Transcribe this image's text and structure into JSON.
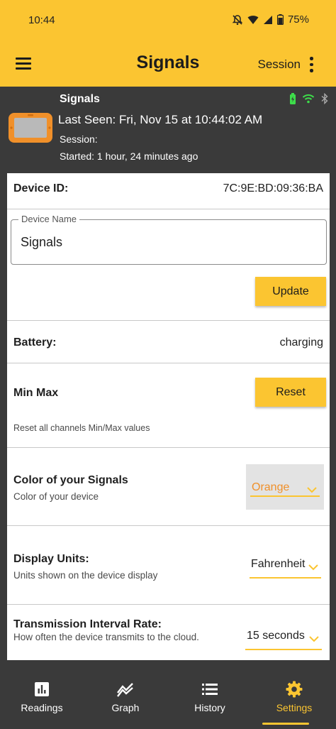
{
  "status_bar": {
    "time": "10:44",
    "battery_pct": "75%",
    "icons": [
      "mute-icon",
      "wifi-icon",
      "signal-icon",
      "battery-icon"
    ]
  },
  "app_bar": {
    "title": "Signals",
    "session_label": "Session",
    "menu_icon": "hamburger-icon",
    "more_icon": "kebab-icon"
  },
  "device_header": {
    "name": "Signals",
    "last_seen": "Last Seen:  Fri, Nov 15  at 10:44:02 AM",
    "session": "Session:",
    "started": "Started: 1 hour, 24 minutes ago",
    "status_icons": [
      "battery-charging-icon",
      "wifi-icon",
      "bluetooth-icon"
    ]
  },
  "settings": {
    "device_id_label": "Device ID:",
    "device_id_value": "7C:9E:BD:09:36:BA",
    "device_name_legend": "Device Name",
    "device_name_value": "Signals",
    "update_label": "Update",
    "battery_label": "Battery:",
    "battery_value": "charging",
    "minmax_label": "Min Max",
    "reset_label": "Reset",
    "minmax_sub": "Reset all channels Min/Max values",
    "color_label": "Color of your Signals",
    "color_sub": "Color of your device",
    "color_value": "Orange",
    "units_label": "Display Units:",
    "units_sub": "Units shown on the device display",
    "units_value": "Fahrenheit",
    "interval_label": "Transmission Interval Rate:",
    "interval_sub": "How often the device transmits to the cloud.",
    "interval_value": "15 seconds"
  },
  "bottom_nav": [
    {
      "label": "Readings",
      "icon": "bar-chart-icon",
      "active": false
    },
    {
      "label": "Graph",
      "icon": "graph-icon",
      "active": false
    },
    {
      "label": "History",
      "icon": "list-icon",
      "active": false
    },
    {
      "label": "Settings",
      "icon": "gear-icon",
      "active": true
    }
  ],
  "colors": {
    "accent": "#fbc531",
    "dark_bg": "#3a3a3a",
    "orange": "#f0902a",
    "green": "#3ddc4a"
  }
}
